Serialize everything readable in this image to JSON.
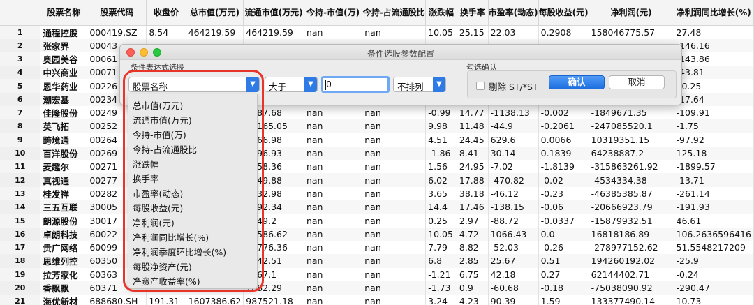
{
  "table": {
    "columns": [
      "",
      "股票名称",
      "股票代码",
      "收盘价",
      "总市值(万元)",
      "流通市值(万元)",
      "今持-市值(万)",
      "今持-占流通股比",
      "涨跌幅",
      "换手率",
      "市盈率(动态)",
      "每股收益(元)",
      "净利润(元)",
      "净利润同比增长(%)"
    ],
    "rows": [
      [
        "1",
        "通程控股",
        "000419.SZ",
        "8.54",
        "464219.59",
        "464219.59",
        "nan",
        "nan",
        "10.05",
        "25.15",
        "22.03",
        "0.2908",
        "158046775.57",
        "27.48"
      ],
      [
        "2",
        "张家界",
        "00043",
        "",
        "",
        "",
        "",
        "",
        "",
        "",
        "",
        "",
        "",
        "-146.16"
      ],
      [
        "3",
        "奥园美谷",
        "00061",
        "",
        "",
        "",
        "",
        "",
        "",
        "",
        "",
        "",
        "",
        "-143.86"
      ],
      [
        "4",
        "中兴商业",
        "00071",
        "",
        "",
        "",
        "",
        "",
        "",
        "",
        "",
        "",
        "",
        "-43.81"
      ],
      [
        "5",
        "恩华药业",
        "00226",
        "",
        "",
        "",
        "",
        "",
        "",
        "",
        "",
        "",
        "",
        "10.25"
      ],
      [
        "6",
        "潮宏基",
        "00234",
        "",
        "",
        "",
        "",
        "",
        "",
        "",
        "",
        "",
        "",
        "-17.64"
      ],
      [
        "7",
        "佳隆股份",
        "00249",
        "",
        "",
        "0687.68",
        "nan",
        "nan",
        "-0.99",
        "14.77",
        "-1138.13",
        "-0.002",
        "-1849671.35",
        "-109.91"
      ],
      [
        "8",
        "英飞拓",
        "00252",
        "",
        "",
        "79165.05",
        "nan",
        "nan",
        "9.98",
        "11.48",
        "-44.9",
        "-0.2061",
        "-247085520.1",
        "-1.75"
      ],
      [
        "9",
        "跨境通",
        "00264",
        "",
        "",
        "1266.98",
        "nan",
        "nan",
        "4.51",
        "24.45",
        "629.6",
        "0.0066",
        "10319351.15",
        "-97.92"
      ],
      [
        "10",
        "百洋股份",
        "00269",
        "",
        "",
        "8196.93",
        "nan",
        "nan",
        "-1.86",
        "8.41",
        "30.14",
        "0.1839",
        "64238887.2",
        "125.18"
      ],
      [
        "11",
        "麦趣尔",
        "00271",
        "",
        "",
        "9458.36",
        "nan",
        "nan",
        "1.56",
        "24.95",
        "-7.02",
        "-1.8139",
        "-315863261.92",
        "-1899.57"
      ],
      [
        "12",
        "真视通",
        "00277",
        "",
        "",
        "4649.88",
        "nan",
        "nan",
        "6.02",
        "17.88",
        "-470.82",
        "-0.02",
        "-4534334.38",
        "-13.71"
      ],
      [
        "13",
        "桂发祥",
        "00282",
        "",
        "",
        "5232.98",
        "nan",
        "nan",
        "3.65",
        "38.18",
        "-46.12",
        "-0.23",
        "-46385385.87",
        "-261.14"
      ],
      [
        "14",
        "三五互联",
        "30005",
        "",
        "",
        "0692.34",
        "nan",
        "nan",
        "14.4",
        "17.46",
        "-138.15",
        "-0.06",
        "-20666923.79",
        "-191.93"
      ],
      [
        "15",
        "朗源股份",
        "30017",
        "",
        "",
        "7849.2",
        "nan",
        "nan",
        "0.25",
        "2.97",
        "-88.72",
        "-0.0337",
        "-15879932.51",
        "46.61"
      ],
      [
        "16",
        "卓朗科技",
        "60022",
        "",
        "",
        "89586.62",
        "nan",
        "nan",
        "10.05",
        "4.72",
        "1066.43",
        "0.0",
        "16818186.89",
        "106.2636596416"
      ],
      [
        "17",
        "贵广网络",
        "60099",
        "",
        "",
        "23776.36",
        "nan",
        "nan",
        "7.79",
        "8.82",
        "-52.03",
        "-0.26",
        "-278977152.62",
        "51.5548217209"
      ],
      [
        "18",
        "思维列控",
        "60350",
        "",
        "",
        "4942.51",
        "nan",
        "nan",
        "6.8",
        "2.85",
        "25.67",
        "0.51",
        "194260192.02",
        "-25.9"
      ],
      [
        "19",
        "拉芳家化",
        "60363",
        "",
        "",
        "9067.1",
        "nan",
        "nan",
        "-1.21",
        "6.75",
        "42.18",
        "0.27",
        "62144402.71",
        "-0.24"
      ],
      [
        "20",
        "香飘飘",
        "60371",
        "",
        "",
        "7082.29",
        "nan",
        "nan",
        "-1.73",
        "0.9",
        "-60.68",
        "-0.18",
        "-75038090.92",
        "-290.47"
      ],
      [
        "21",
        "海优新材",
        "688680.SH",
        "191.31",
        "1607386.62",
        "987521.18",
        "nan",
        "nan",
        "3.24",
        "4.23",
        "90.39",
        "1.59",
        "133377490.14",
        "10.73"
      ]
    ]
  },
  "dialog": {
    "title": "条件选股参数配置",
    "expr_group_label": "条件表达式选股",
    "confirm_group_label": "勾选确认",
    "field_select_value": "股票名称",
    "operator_select_value": "大于",
    "value_input": "0",
    "sort_select_value": "不排列",
    "exclude_st_label": "剔除 ST/*ST",
    "exclude_st_checked": false,
    "ok_label": "确认",
    "cancel_label": "取消",
    "dropdown_options": [
      "总市值(万元)",
      "流通市值(万元)",
      "今持-市值(万)",
      "今持-占流通股比",
      "涨跌幅",
      "换手率",
      "市盈率(动态)",
      "每股收益(元)",
      "净利润(元)",
      "净利润同比增长(%)",
      "净利润季度环比增长(%)",
      "每股净资产(元)",
      "净资产收益率(%)"
    ]
  },
  "colors": {
    "accent_blue": "#2f7be6",
    "highlight_red": "#e8352a"
  },
  "icons": {
    "dropdown_arrow": "chevron-down-icon"
  }
}
